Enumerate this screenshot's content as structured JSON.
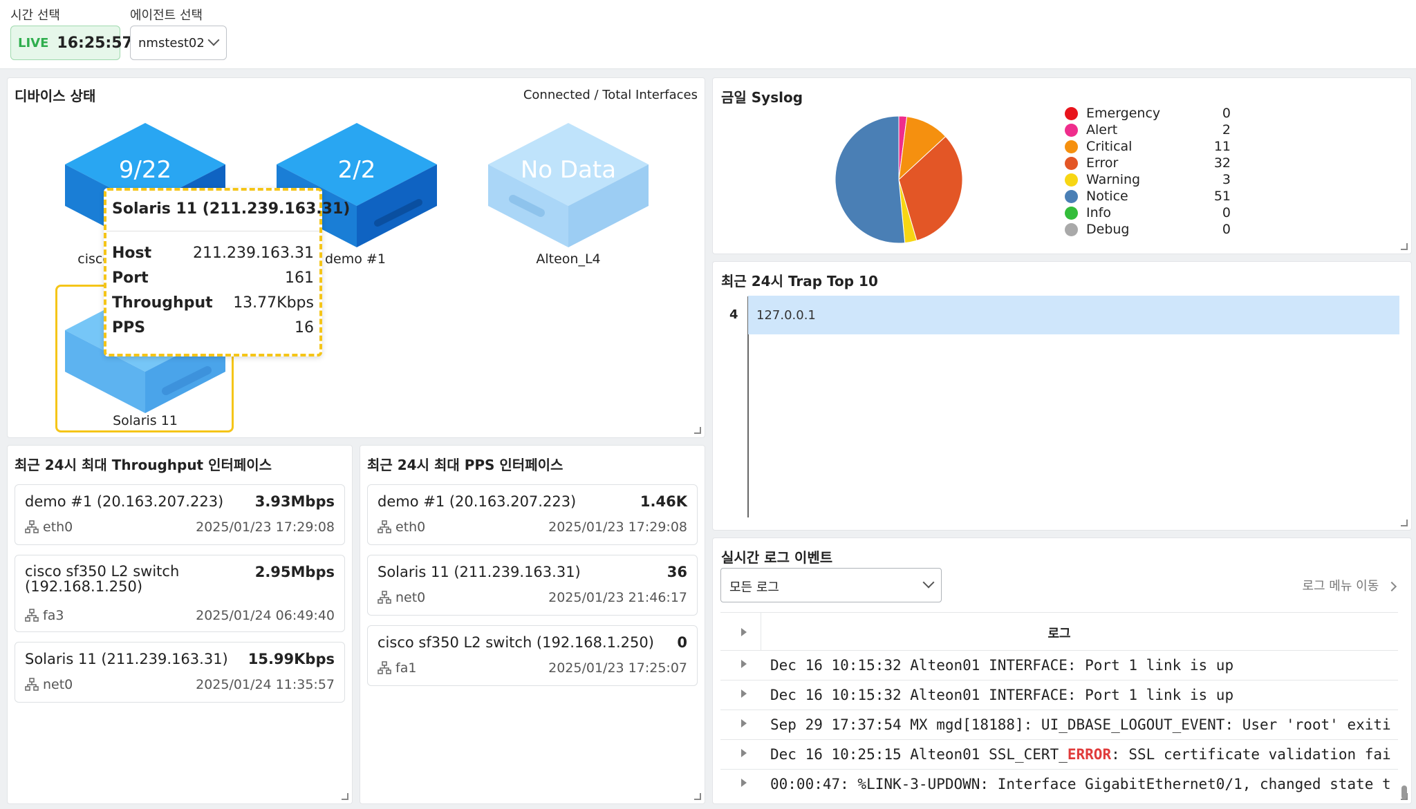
{
  "time_select": {
    "label": "시간 선택",
    "live": "LIVE",
    "time": "16:25:57"
  },
  "agent_select": {
    "label": "에이전트 선택",
    "value": "nmstest02"
  },
  "device_status": {
    "title": "디바이스 상태",
    "subtitle": "Connected / Total Interfaces",
    "devices": [
      {
        "count": "9/22",
        "name": "cisco"
      },
      {
        "count": "2/2",
        "name": "demo #1"
      },
      {
        "count": "No Data",
        "name": "Alteon_L4"
      },
      {
        "count": "",
        "name": "Solaris 11"
      }
    ],
    "tooltip": {
      "title": "Solaris 11 (211.239.163.31)",
      "rows": [
        {
          "key": "Host",
          "value": "211.239.163.31"
        },
        {
          "key": "Port",
          "value": "161"
        },
        {
          "key": "Throughput",
          "value": "13.77Kbps"
        },
        {
          "key": "PPS",
          "value": "16"
        }
      ]
    }
  },
  "throughput_panel": {
    "title": "최근 24시 최대 Throughput 인터페이스",
    "items": [
      {
        "name": "demo #1 (20.163.207.223)",
        "value": "3.93Mbps",
        "port": "eth0",
        "date": "2025/01/23 17:29:08"
      },
      {
        "name": "cisco sf350 L2 switch",
        "name2": "(192.168.1.250)",
        "value": "2.95Mbps",
        "port": "fa3",
        "date": "2025/01/24 06:49:40"
      },
      {
        "name": "Solaris 11 (211.239.163.31)",
        "value": "15.99Kbps",
        "port": "net0",
        "date": "2025/01/24 11:35:57"
      }
    ]
  },
  "pps_panel": {
    "title": "최근 24시 최대 PPS 인터페이스",
    "items": [
      {
        "name": "demo #1 (20.163.207.223)",
        "value": "1.46K",
        "port": "eth0",
        "date": "2025/01/23 17:29:08"
      },
      {
        "name": "Solaris 11 (211.239.163.31)",
        "value": "36",
        "port": "net0",
        "date": "2025/01/23 21:46:17"
      },
      {
        "name": "cisco sf350 L2 switch (192.168.1.250)",
        "value": "0",
        "port": "fa1",
        "date": "2025/01/23 17:25:07"
      }
    ]
  },
  "syslog": {
    "title": "금일 Syslog",
    "legend": [
      {
        "label": "Emergency",
        "value": "0",
        "color": "#e8141c"
      },
      {
        "label": "Alert",
        "value": "2",
        "color": "#ef2d8c"
      },
      {
        "label": "Critical",
        "value": "11",
        "color": "#f5900f"
      },
      {
        "label": "Error",
        "value": "32",
        "color": "#e35626"
      },
      {
        "label": "Warning",
        "value": "3",
        "color": "#f7d614"
      },
      {
        "label": "Notice",
        "value": "51",
        "color": "#4a7fb5"
      },
      {
        "label": "Info",
        "value": "0",
        "color": "#33bd3a"
      },
      {
        "label": "Debug",
        "value": "0",
        "color": "#a9a9a9"
      }
    ]
  },
  "chart_data": {
    "type": "pie",
    "categories": [
      "Emergency",
      "Alert",
      "Critical",
      "Error",
      "Warning",
      "Notice",
      "Info",
      "Debug"
    ],
    "values": [
      0,
      2,
      11,
      32,
      3,
      51,
      0,
      0
    ]
  },
  "trap": {
    "title": "최근 24시 Trap Top 10",
    "items": [
      {
        "count": "4",
        "ip": "127.0.0.1"
      }
    ]
  },
  "log_events": {
    "title": "실시간 로그 이벤트",
    "filter": "모든 로그",
    "menu_link": "로그 메뉴 이동",
    "header": "로그",
    "rows": [
      {
        "text": "Dec 16 10:15:32 Alteon01 INTERFACE: Port 1 link is up"
      },
      {
        "text": "Dec 16 10:15:32 Alteon01 INTERFACE: Port 1 link is up"
      },
      {
        "text": "Sep 29 17:37:54 MX mgd[18188]: UI_DBASE_LOGOUT_EVENT: User 'root' exiti"
      },
      {
        "pre": "Dec 16 10:25:15 Alteon01 SSL_CERT_",
        "err": "ERROR",
        "post": ": SSL certificate validation fai"
      },
      {
        "text": "00:00:47: %LINK-3-UPDOWN: Interface GigabitEthernet0/1, changed state t"
      }
    ]
  }
}
